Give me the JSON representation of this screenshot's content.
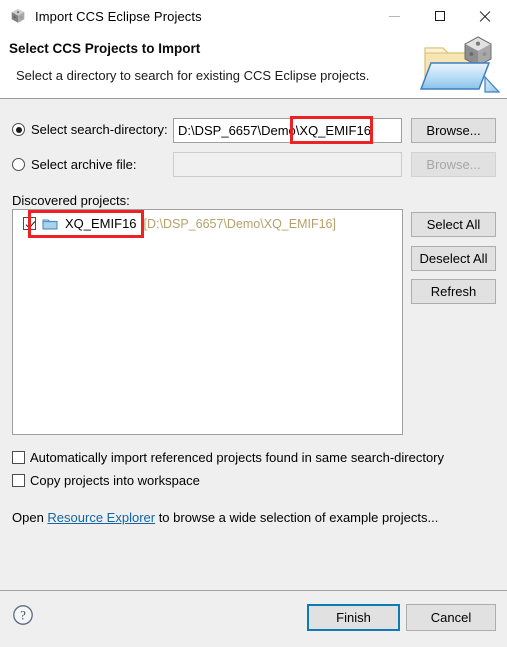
{
  "window": {
    "title": "Import CCS Eclipse Projects",
    "icon": "ccs-cube-icon",
    "controls": {
      "minimize": "minimize-icon",
      "maximize": "maximize-icon",
      "close": "close-icon"
    }
  },
  "header": {
    "title": "Select CCS Projects to Import",
    "subtitle": "Select a directory to search for existing CCS Eclipse projects.",
    "banner_icon": "import-folder-cube-icon"
  },
  "form": {
    "search_directory": {
      "radio_label": "Select search-directory:",
      "selected": true,
      "value": "D:\\DSP_6657\\Demo\\XQ_EMIF16",
      "browse_label": "Browse..."
    },
    "archive_file": {
      "radio_label": "Select archive file:",
      "selected": false,
      "value": "",
      "placeholder": "",
      "browse_label": "Browse...",
      "disabled": true
    }
  },
  "discovered": {
    "label": "Discovered projects:",
    "projects": [
      {
        "name": "XQ_EMIF16",
        "path": "[D:\\DSP_6657\\Demo\\XQ_EMIF16]",
        "checked": true,
        "icon": "folder-icon"
      }
    ],
    "buttons": {
      "select_all": "Select All",
      "deselect_all": "Deselect All",
      "refresh": "Refresh"
    }
  },
  "options": {
    "auto_import": {
      "label": "Automatically import referenced projects found in same search-directory",
      "checked": false
    },
    "copy_projects": {
      "label": "Copy projects into workspace",
      "checked": false
    },
    "resource_link": {
      "prefix": "Open ",
      "link_text": "Resource Explorer",
      "suffix": " to browse a wide selection of example projects..."
    }
  },
  "footer": {
    "help_icon": "help-question-icon",
    "finish_label": "Finish",
    "cancel_label": "Cancel"
  },
  "annotations": {
    "accent_color": "#ee2222",
    "highlight_path_text": "XQ_EMIF16",
    "highlight_project_row": "XQ_EMIF16"
  }
}
